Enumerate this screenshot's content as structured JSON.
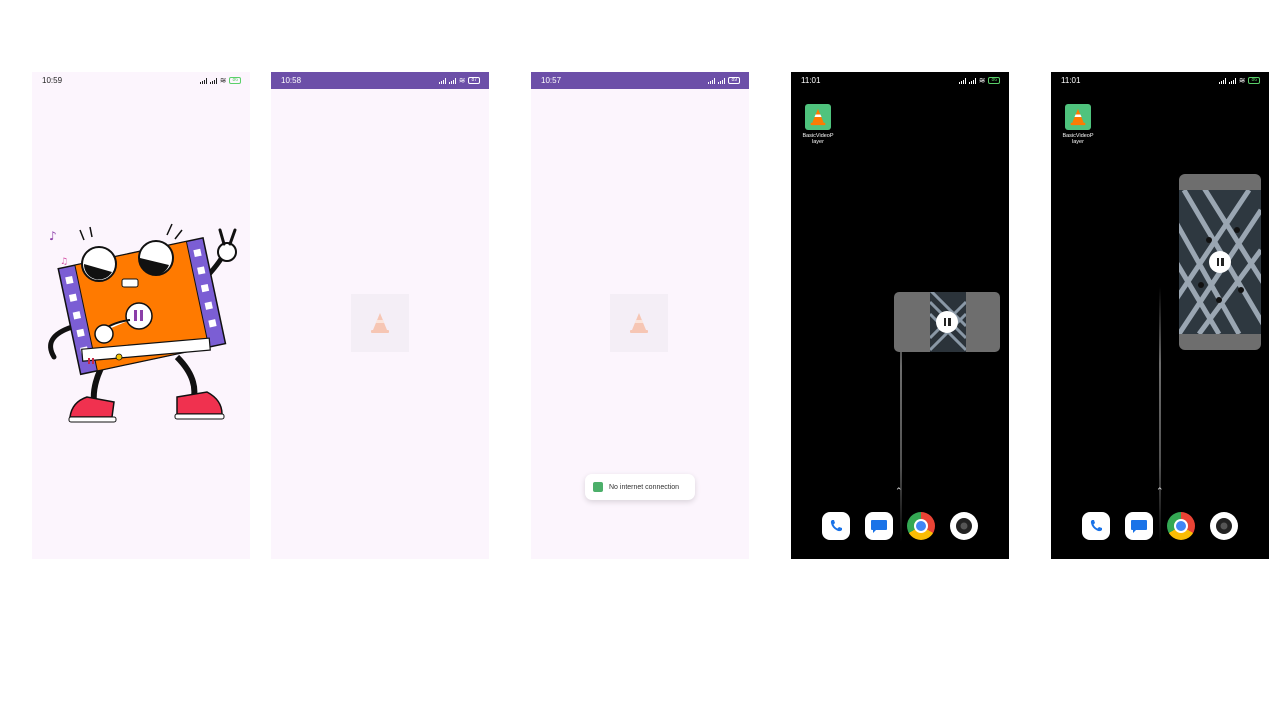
{
  "screens": [
    {
      "status_time": "10:59"
    },
    {
      "status_time": "10:58"
    },
    {
      "status_time": "10:57",
      "toast_text": "No internet connection"
    },
    {
      "status_time": "11:01",
      "app_label": "BasicVideoP\nlayer"
    },
    {
      "status_time": "11:01",
      "app_label": "BasicVideoP\nlayer"
    }
  ],
  "battery_labels": [
    "86",
    "87",
    "89",
    "86",
    "86"
  ],
  "colors": {
    "app_background": "#fcf5fd",
    "status_bar_accent": "#6c4fa8",
    "home_background": "#000000",
    "launcher_green": "#4fc37d"
  },
  "icons": {
    "app": "vlc-cone-icon",
    "dock": [
      "phone-icon",
      "messages-icon",
      "chrome-icon",
      "camera-icon"
    ],
    "pip_control": "pause-icon"
  }
}
